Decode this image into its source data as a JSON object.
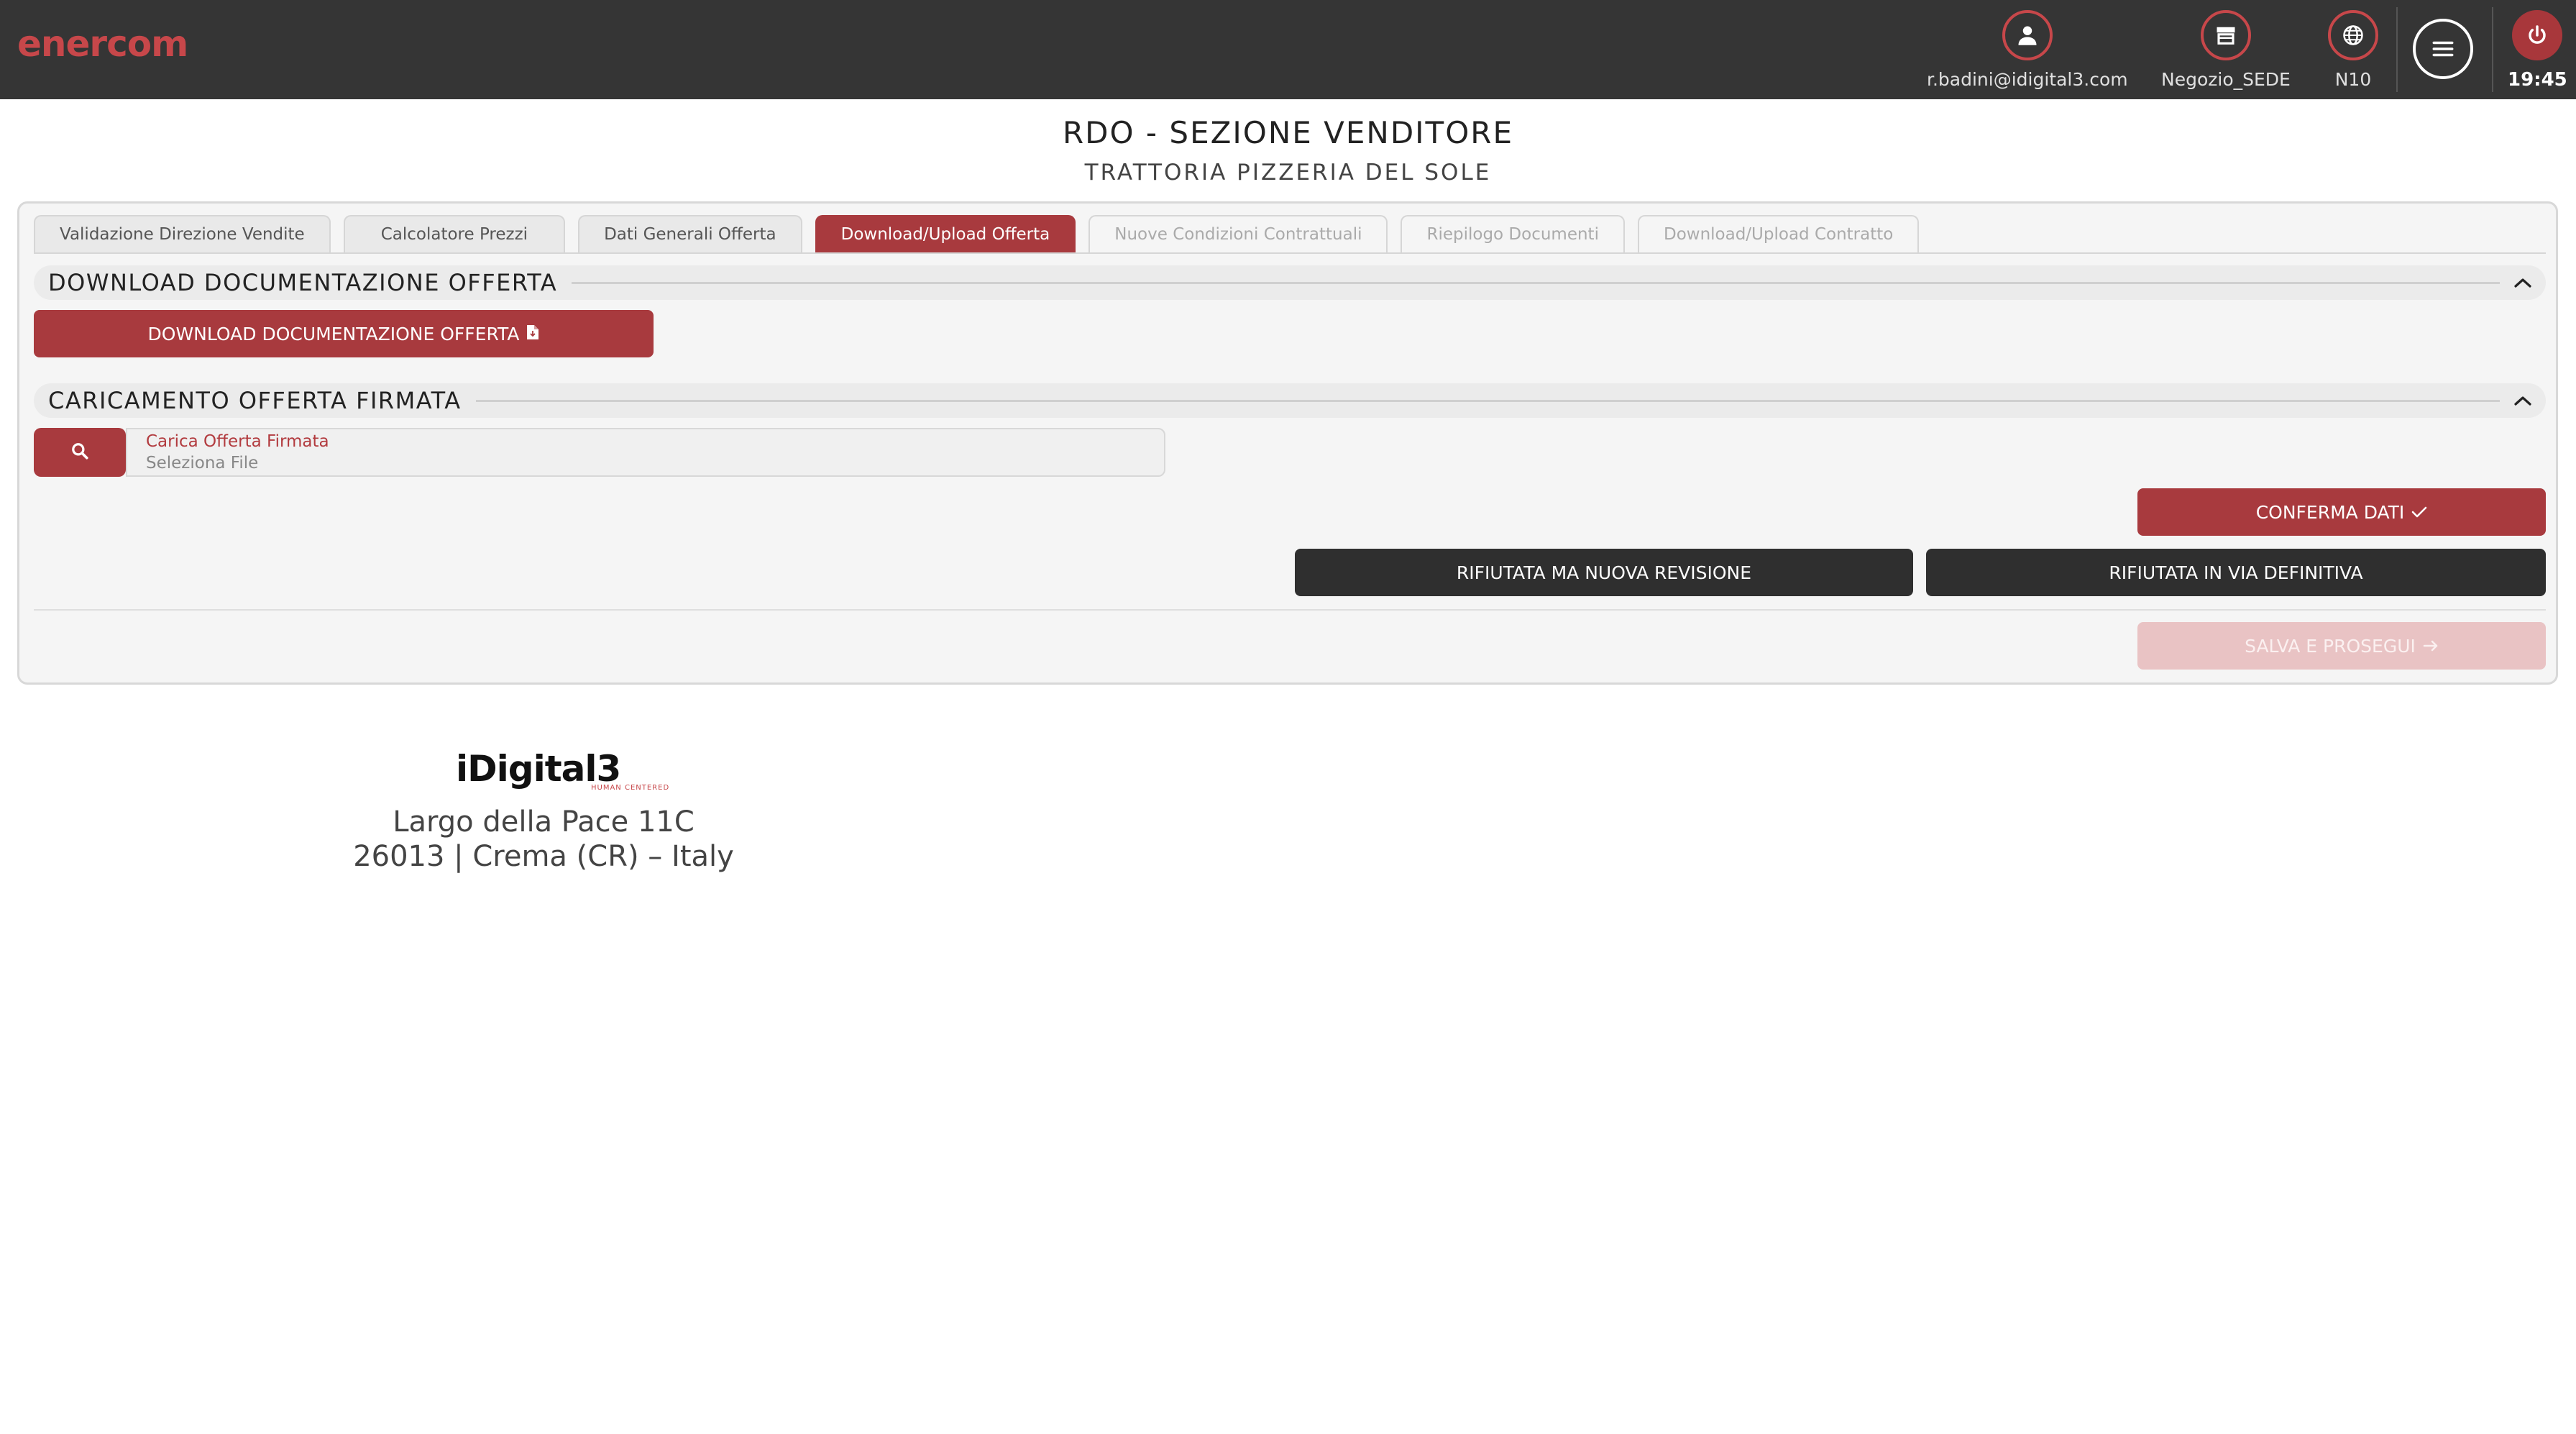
{
  "header": {
    "logo": "enercom",
    "user": {
      "label": "r.badini@idigital3.com",
      "icon": "user-icon"
    },
    "store": {
      "label": "Negozio_SEDE",
      "icon": "store-icon"
    },
    "region": {
      "label": "N10",
      "icon": "globe-icon"
    },
    "menu_icon": "hamburger-menu-icon",
    "power_icon": "power-icon",
    "time": "19:45"
  },
  "page": {
    "title": "RDO - SEZIONE VENDITORE",
    "subtitle": "TRATTORIA PIZZERIA DEL SOLE"
  },
  "tabs": [
    {
      "label": "Validazione Direzione Vendite",
      "state": "normal"
    },
    {
      "label": "Calcolatore Prezzi",
      "state": "normal"
    },
    {
      "label": "Dati Generali Offerta",
      "state": "normal"
    },
    {
      "label": "Download/Upload Offerta",
      "state": "active"
    },
    {
      "label": "Nuove Condizioni Contrattuali",
      "state": "disabled"
    },
    {
      "label": "Riepilogo Documenti",
      "state": "disabled"
    },
    {
      "label": "Download/Upload Contratto",
      "state": "disabled"
    }
  ],
  "download_section": {
    "title": "DOWNLOAD DOCUMENTAZIONE OFFERTA",
    "button_label": "DOWNLOAD DOCUMENTAZIONE OFFERTA"
  },
  "upload_section": {
    "title": "CARICAMENTO OFFERTA FIRMATA",
    "file_label": "Carica Offerta Firmata",
    "file_placeholder": "Seleziona File"
  },
  "actions": {
    "confirm": "CONFERMA DATI",
    "rejected_revision": "RIFIUTATA MA NUOVA REVISIONE",
    "rejected_final": "RIFIUTATA IN VIA DEFINITIVA",
    "save_continue": "SALVA E PROSEGUI"
  },
  "footer": {
    "logo_name": "iDigital3",
    "logo_tag": "HUMAN CENTERED",
    "address_line1": "Largo della Pace 11C",
    "address_line2": "26013 | Crema (CR) – Italy"
  },
  "colors": {
    "brand_red": "#a83a3e",
    "topbar": "#353535",
    "dark_button": "#2f2f2f"
  }
}
